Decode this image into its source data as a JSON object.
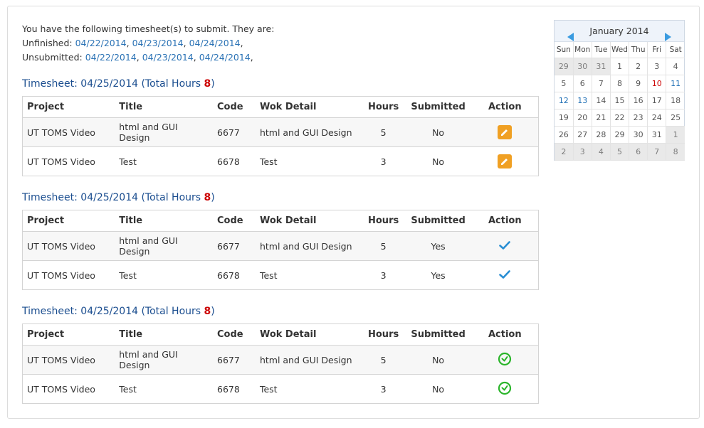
{
  "intro": {
    "line1": "You have the following timesheet(s) to submit. They are:",
    "unfinished_label": "Unfinished: ",
    "unfinished_links": [
      "04/22/2014",
      "04/23/2014",
      "04/24/2014"
    ],
    "unsubmitted_label": "Unsubmitted: ",
    "unsubmitted_links": [
      "04/22/2014",
      "04/23/2014",
      "04/24/2014"
    ],
    "sep": ", ",
    "trail": ","
  },
  "columns": [
    "Project",
    "Title",
    "Code",
    "Wok Detail",
    "Hours",
    "Submitted",
    "Action"
  ],
  "timesheets": [
    {
      "prefix": "Timesheet: 04/25/2014 (Total Hours ",
      "total": "8",
      "suffix": ")",
      "rows": [
        {
          "project": "UT TOMS Video",
          "title": "html and GUI Design",
          "code": "6677",
          "detail": "html and GUI Design",
          "hours": "5",
          "submitted": "No",
          "action": "edit-icon"
        },
        {
          "project": "UT TOMS Video",
          "title": "Test",
          "code": "6678",
          "detail": "Test",
          "hours": "3",
          "submitted": "No",
          "action": "edit-icon"
        }
      ]
    },
    {
      "prefix": "Timesheet: 04/25/2014 (Total Hours ",
      "total": "8",
      "suffix": ")",
      "rows": [
        {
          "project": "UT TOMS Video",
          "title": "html and GUI Design",
          "code": "6677",
          "detail": "html and GUI Design",
          "hours": "5",
          "submitted": "Yes",
          "action": "check-icon"
        },
        {
          "project": "UT TOMS Video",
          "title": "Test",
          "code": "6678",
          "detail": "Test",
          "hours": "3",
          "submitted": "Yes",
          "action": "check-icon"
        }
      ]
    },
    {
      "prefix": "Timesheet: 04/25/2014 (Total Hours ",
      "total": "8",
      "suffix": ")",
      "rows": [
        {
          "project": "UT TOMS Video",
          "title": "html and GUI Design",
          "code": "6677",
          "detail": "html and GUI Design",
          "hours": "5",
          "submitted": "No",
          "action": "clock-icon"
        },
        {
          "project": "UT TOMS Video",
          "title": "Test",
          "code": "6678",
          "detail": "Test",
          "hours": "3",
          "submitted": "No",
          "action": "clock-icon"
        }
      ]
    }
  ],
  "calendar": {
    "month_label": "January 2014",
    "weekdays": [
      "Sun",
      "Mon",
      "Tue",
      "Wed",
      "Thu",
      "Fri",
      "Sat"
    ],
    "weeks": [
      [
        "29",
        "30",
        "31",
        "1",
        "2",
        "3",
        "4"
      ],
      [
        "5",
        "6",
        "7",
        "8",
        "9",
        "10",
        "11"
      ],
      [
        "12",
        "13",
        "14",
        "15",
        "16",
        "17",
        "18"
      ],
      [
        "19",
        "20",
        "21",
        "22",
        "23",
        "24",
        "25"
      ],
      [
        "26",
        "27",
        "28",
        "29",
        "30",
        "31",
        "1"
      ],
      [
        "2",
        "3",
        "4",
        "5",
        "6",
        "7",
        "8"
      ]
    ]
  },
  "colors": {
    "link": "#2a72b5",
    "title": "#1a4d8f",
    "total_hours": "#cc0000",
    "edit_button": "#f0a023",
    "check": "#2a8fd4",
    "clock": "#2bb52b"
  }
}
